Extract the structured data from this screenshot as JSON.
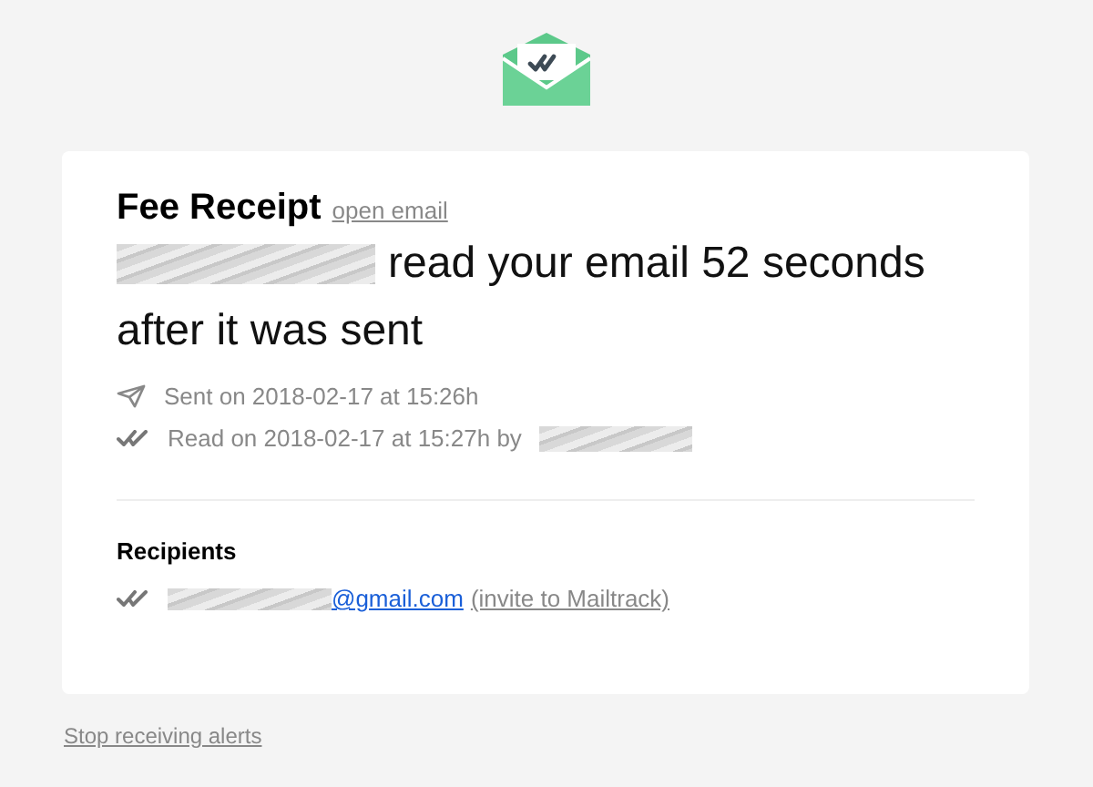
{
  "card": {
    "title": "Fee Receipt",
    "open_link": "open email",
    "message_lines": [
      "read your email 52 seconds",
      "after it was sent"
    ],
    "events": [
      {
        "kind": "sent",
        "text": "Sent on 2018-02-17 at 15:26h",
        "redacted_suffix": false
      },
      {
        "kind": "read",
        "text": "Read on 2018-02-17 at 15:27h by",
        "redacted_suffix": true
      }
    ],
    "recipients": {
      "heading": "Recipients",
      "items": [
        {
          "kind": "read",
          "email": "@gmail.com",
          "invite": "(invite to Mailtrack)"
        }
      ]
    }
  },
  "footer": {
    "link": "Stop receiving alerts"
  }
}
